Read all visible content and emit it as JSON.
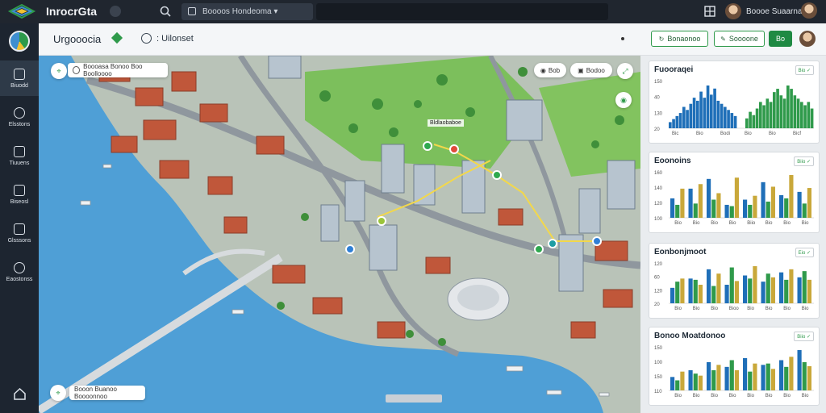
{
  "topbar": {
    "brand": "InrocrGta",
    "search_text": "Boooos  Hondeoma ▾",
    "user_name": "Boooe Suaarna"
  },
  "sidebar": {
    "items": [
      {
        "label": "Biuodd",
        "icon": "home-icon"
      },
      {
        "label": "Elsstons",
        "icon": "globe-icon"
      },
      {
        "label": "Tiuuens",
        "icon": "layers-icon"
      },
      {
        "label": "Biseosl",
        "icon": "document-icon"
      },
      {
        "label": "Glsssons",
        "icon": "building-icon"
      },
      {
        "label": "Eaostonss",
        "icon": "settings-icon"
      }
    ]
  },
  "subbar": {
    "title": "Urgooocia",
    "tab": ": Uilonset",
    "btn1": "Bonaonoo",
    "btn2": "Soooone",
    "btn3": "Bo"
  },
  "map": {
    "search_chip": "Boooasa  Bonoo Boo  Boolloooo",
    "bottom_chip": "Booon  Buanoo  Boooonnoo",
    "pill1": "Bob",
    "pill2": "Bodoo",
    "label_marker": "Bldlaobaboe"
  },
  "colors": {
    "accent": "#2f9a4b",
    "bar_blue": "#1f6fb8",
    "bar_green": "#2f9a4b",
    "bar_gold": "#c9a83a",
    "water": "#4f9fd6"
  },
  "panel": {
    "cards": [
      {
        "title": "Fuooraqei",
        "control": "Bio ✓"
      },
      {
        "title": "Eoonoins",
        "control": "Biio ✓"
      },
      {
        "title": "Eonbonjmoot",
        "control": "Eio ✓"
      },
      {
        "title": "Bonoo Moatdonoo",
        "control": "Biio ✓"
      }
    ]
  },
  "chart_data": [
    {
      "type": "bar",
      "title": "Fuooraqei",
      "series": [
        {
          "values": [
            2,
            3,
            4,
            5,
            7,
            6,
            8,
            10,
            9,
            12,
            10,
            14,
            11,
            13,
            9,
            8,
            7,
            6,
            5,
            4
          ]
        },
        {
          "values": [
            3,
            5,
            4,
            6,
            8,
            7,
            9,
            8,
            11,
            12,
            10,
            9,
            13,
            12,
            10,
            9,
            8,
            7,
            8,
            6
          ]
        }
      ],
      "x_tick_labels": [
        "Bic",
        "Bio",
        "Bodi",
        "Bio",
        "Bio",
        "Bicf"
      ],
      "y_tick_labels": [
        "150",
        "40",
        "130",
        "20"
      ]
    },
    {
      "type": "bar",
      "title": "Eoonoins",
      "categories": [
        "Bio",
        "Bio",
        "Bio",
        "Bio",
        "Biio",
        "Bio",
        "Bio",
        "Bio"
      ],
      "series": [
        {
          "name": "Bio",
          "values": [
            30,
            45,
            60,
            20,
            28,
            55,
            35,
            40
          ]
        },
        {
          "name": "Biio",
          "values": [
            20,
            22,
            28,
            18,
            20,
            25,
            30,
            22
          ]
        },
        {
          "name": "Bio",
          "values": [
            45,
            52,
            38,
            62,
            34,
            48,
            66,
            46
          ]
        }
      ],
      "y_tick_labels": [
        "160",
        "140",
        "120",
        "100"
      ]
    },
    {
      "type": "bar",
      "title": "Eonbonjmoot",
      "categories": [
        "Bio",
        "Bio",
        "Bio",
        "Bioo",
        "Bio",
        "Bio",
        "Bio",
        "Bio"
      ],
      "series": [
        {
          "name": "Bio",
          "values": [
            25,
            40,
            55,
            30,
            45,
            35,
            50,
            42
          ]
        },
        {
          "name": "Bio",
          "values": [
            35,
            38,
            28,
            58,
            40,
            48,
            38,
            52
          ]
        },
        {
          "name": "Bio",
          "values": [
            40,
            30,
            48,
            36,
            60,
            42,
            55,
            38
          ]
        }
      ],
      "y_tick_labels": [
        "120",
        "60",
        "120",
        "20"
      ]
    },
    {
      "type": "bar",
      "title": "Bonoo Moatdonoo",
      "categories": [
        "Bio",
        "Bio",
        "Bio",
        "Bio",
        "Bio",
        "Bio",
        "Bio",
        "Bio"
      ],
      "series": [
        {
          "name": "Bio",
          "values": [
            20,
            30,
            42,
            35,
            48,
            38,
            45,
            60
          ]
        },
        {
          "name": "Bio",
          "values": [
            15,
            25,
            30,
            45,
            28,
            40,
            35,
            42
          ]
        },
        {
          "name": "Bio",
          "values": [
            28,
            22,
            38,
            30,
            40,
            32,
            50,
            36
          ]
        }
      ],
      "y_tick_labels": [
        "150",
        "100",
        "150",
        "110"
      ]
    }
  ]
}
